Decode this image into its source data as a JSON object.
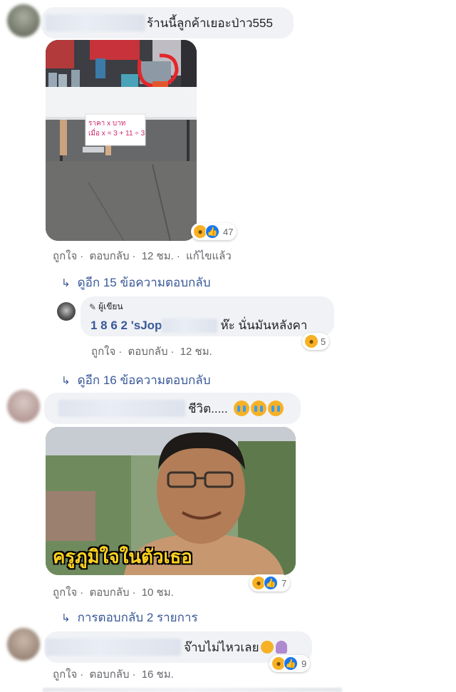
{
  "comment1": {
    "text": "ร้านนี้ลูกค้าเยอะป่าว555",
    "sign": {
      "line1": "ราคา x บาท",
      "line2": "เมื่อ x = 3 + 11 ÷ 3"
    },
    "reactions": {
      "count": "47",
      "icons": [
        "haha-icon",
        "like-icon"
      ]
    },
    "actions": {
      "like": "ถูกใจ",
      "reply": "ตอบกลับ",
      "time": "12 ชม.",
      "edited": "แก้ไขแล้ว"
    },
    "more_replies": "ดูอีก 15 ข้อความตอบกลับ"
  },
  "reply1": {
    "author_badge": "ผู้เขียน",
    "name_digits": "1 8 6 2 's",
    "name_part": "Jop",
    "text": "ห๊ะ นั่นมันหลังคา",
    "reactions": {
      "count": "5",
      "icons": [
        "haha-icon"
      ]
    },
    "actions": {
      "like": "ถูกใจ",
      "reply": "ตอบกลับ",
      "time": "12 ชม."
    },
    "more_replies": "ดูอีก 16 ข้อความตอบกลับ"
  },
  "comment2": {
    "text": "ชีวิต.....",
    "meme_caption": "ครูภูมิใจในตัวเธอ",
    "reactions": {
      "count": "7",
      "icons": [
        "haha-icon",
        "like-icon"
      ]
    },
    "actions": {
      "like": "ถูกใจ",
      "reply": "ตอบกลับ",
      "time": "10 ชม."
    },
    "more_replies": "การตอบกลับ 2 รายการ"
  },
  "comment3": {
    "text": "จ๊าบไม่ไหวเลย",
    "reactions": {
      "count": "9",
      "icons": [
        "haha-icon",
        "like-icon"
      ]
    },
    "actions": {
      "like": "ถูกใจ",
      "reply": "ตอบกลับ",
      "time": "16 ชม."
    }
  },
  "colors": {
    "bubble": "#f0f2f5",
    "link": "#385898",
    "meta": "#65676b",
    "haha": "#f7b125",
    "like": "#1877f2",
    "caption": "#ffd21f"
  }
}
